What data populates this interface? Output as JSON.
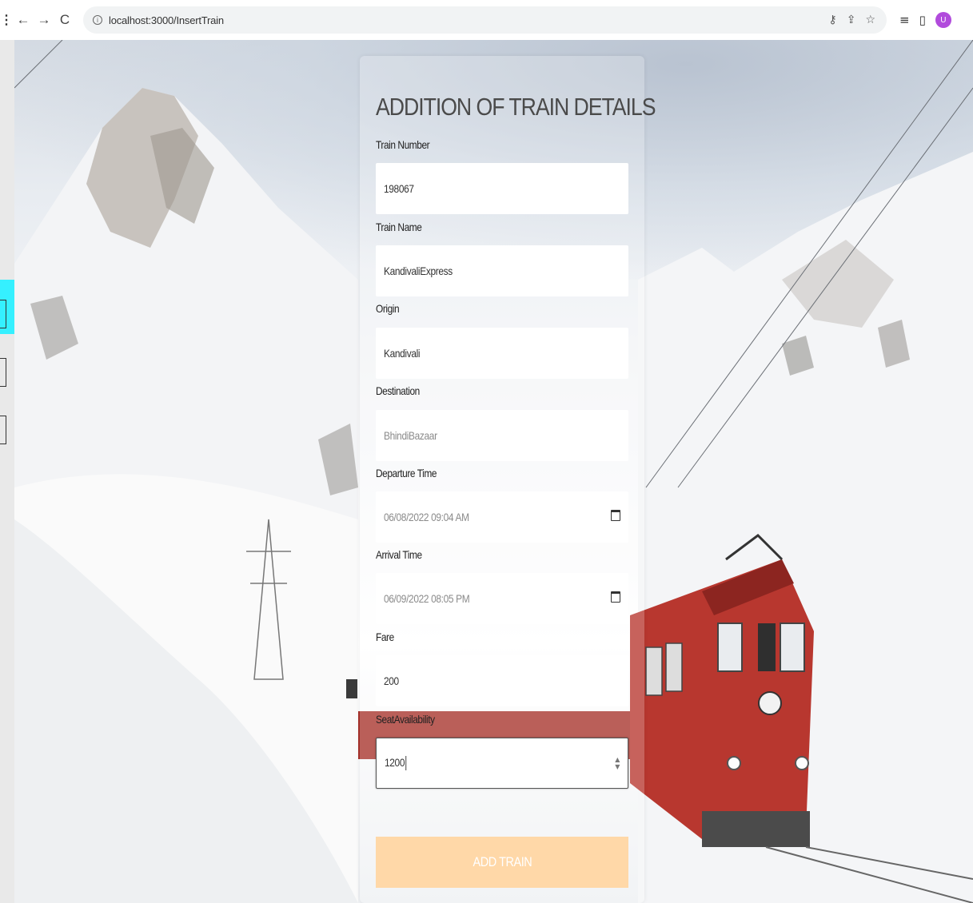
{
  "browser": {
    "url": "localhost:3000/InsertTrain",
    "profile_initial": "U",
    "icons": [
      "menu-kebab-icon",
      "back-arrow-icon",
      "forward-arrow-icon",
      "reload-icon",
      "site-info-icon",
      "key-icon",
      "share-icon",
      "bookmark-star-icon",
      "reading-list-icon",
      "side-panel-icon"
    ]
  },
  "form": {
    "title": "ADDITION OF TRAIN DETAILS",
    "fields": [
      {
        "label": "Train Number",
        "value": "198067"
      },
      {
        "label": "Train Name",
        "value": "KandivaliExpress"
      },
      {
        "label": "Origin",
        "value": "Kandivali"
      },
      {
        "label": "Destination",
        "value": "",
        "placeholder": "BhindiBazaar"
      },
      {
        "label": "Departure Time",
        "value": "06/08/2022 09:04 AM"
      },
      {
        "label": "Arrival Time",
        "value": "06/09/2022 08:05 PM"
      },
      {
        "label": "Fare",
        "value": "200"
      },
      {
        "label": "SeatAvailability",
        "value": "1200"
      }
    ],
    "submit_label": "ADD TRAIN"
  },
  "colors": {
    "button_bg": "#ffd8a8",
    "button_text": "#ffffff",
    "title_text": "#4a4a4a",
    "profile_avatar": "#b14bdc",
    "train_body": "#b8372f"
  }
}
